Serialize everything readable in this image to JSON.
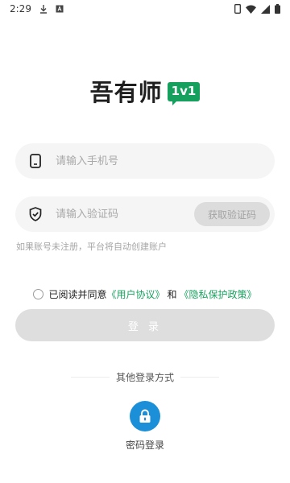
{
  "status_bar": {
    "time": "2:29"
  },
  "logo": {
    "text": "吾有师",
    "badge": "1v1"
  },
  "phone_field": {
    "placeholder": "请输入手机号",
    "icon": "phone-icon"
  },
  "code_field": {
    "placeholder": "请输入验证码",
    "icon": "shield-check-icon",
    "get_code_label": "获取验证码"
  },
  "hint": "如果账号未注册，平台将自动创建账户",
  "agreement": {
    "prefix": "已阅读并同意",
    "user_agreement": "《用户协议》",
    "and": "和",
    "privacy_policy": "《隐私保护政策》"
  },
  "login_button": "登 录",
  "other_methods": "其他登录方式",
  "password_login": {
    "label": "密码登录",
    "icon": "lock-icon"
  },
  "colors": {
    "brand_green": "#16a05d",
    "link_green": "#19a25f",
    "blue_accent": "#1b8fd8"
  }
}
